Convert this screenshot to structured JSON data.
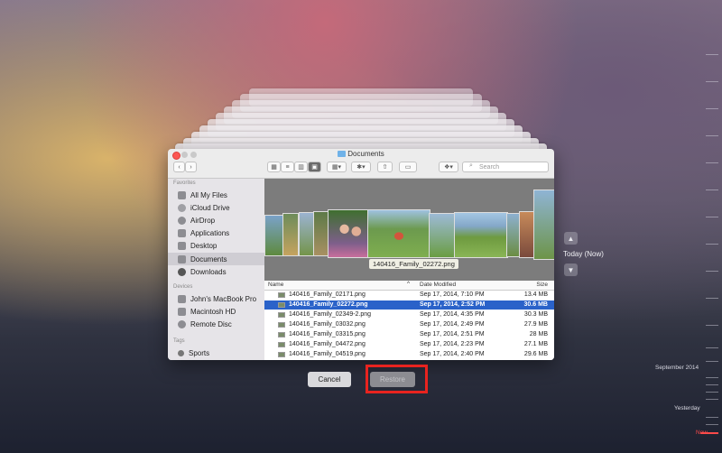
{
  "window": {
    "title": "Documents",
    "search_placeholder": "Search"
  },
  "sidebar": {
    "favorites_header": "Favorites",
    "favorites": [
      {
        "label": "All My Files"
      },
      {
        "label": "iCloud Drive"
      },
      {
        "label": "AirDrop"
      },
      {
        "label": "Applications"
      },
      {
        "label": "Desktop"
      },
      {
        "label": "Documents",
        "selected": true
      },
      {
        "label": "Downloads"
      }
    ],
    "devices_header": "Devices",
    "devices": [
      {
        "label": "John's MacBook Pro"
      },
      {
        "label": "Macintosh HD"
      },
      {
        "label": "Remote Disc"
      }
    ],
    "tags_header": "Tags",
    "tags": [
      {
        "label": "Sports"
      }
    ]
  },
  "preview": {
    "caption": "140416_Family_02272.png"
  },
  "list": {
    "columns": {
      "name": "Name",
      "date": "Date Modified",
      "size": "Size"
    },
    "rows": [
      {
        "name": "140416_Family_02171.png",
        "date": "Sep 17, 2014, 7:10 PM",
        "size": "13.4 MB"
      },
      {
        "name": "140416_Family_02272.png",
        "date": "Sep 17, 2014, 2:52 PM",
        "size": "30.6 MB",
        "selected": true
      },
      {
        "name": "140416_Family_02349-2.png",
        "date": "Sep 17, 2014, 4:35 PM",
        "size": "30.3 MB"
      },
      {
        "name": "140416_Family_03032.png",
        "date": "Sep 17, 2014, 2:49 PM",
        "size": "27.9 MB"
      },
      {
        "name": "140416_Family_03315.png",
        "date": "Sep 17, 2014, 2:51 PM",
        "size": "28 MB"
      },
      {
        "name": "140416_Family_04472.png",
        "date": "Sep 17, 2014, 2:23 PM",
        "size": "27.1 MB"
      },
      {
        "name": "140416_Family_04519.png",
        "date": "Sep 17, 2014, 2:40 PM",
        "size": "29.6 MB"
      }
    ]
  },
  "buttons": {
    "cancel": "Cancel",
    "restore": "Restore"
  },
  "time_machine": {
    "current": "Today (Now)",
    "timeline": [
      "September 2014",
      "Yesterday",
      "Now"
    ]
  },
  "colors": {
    "selection": "#2a62c9",
    "highlight_box": "#e8231f",
    "now_label": "#ff4a4a"
  }
}
